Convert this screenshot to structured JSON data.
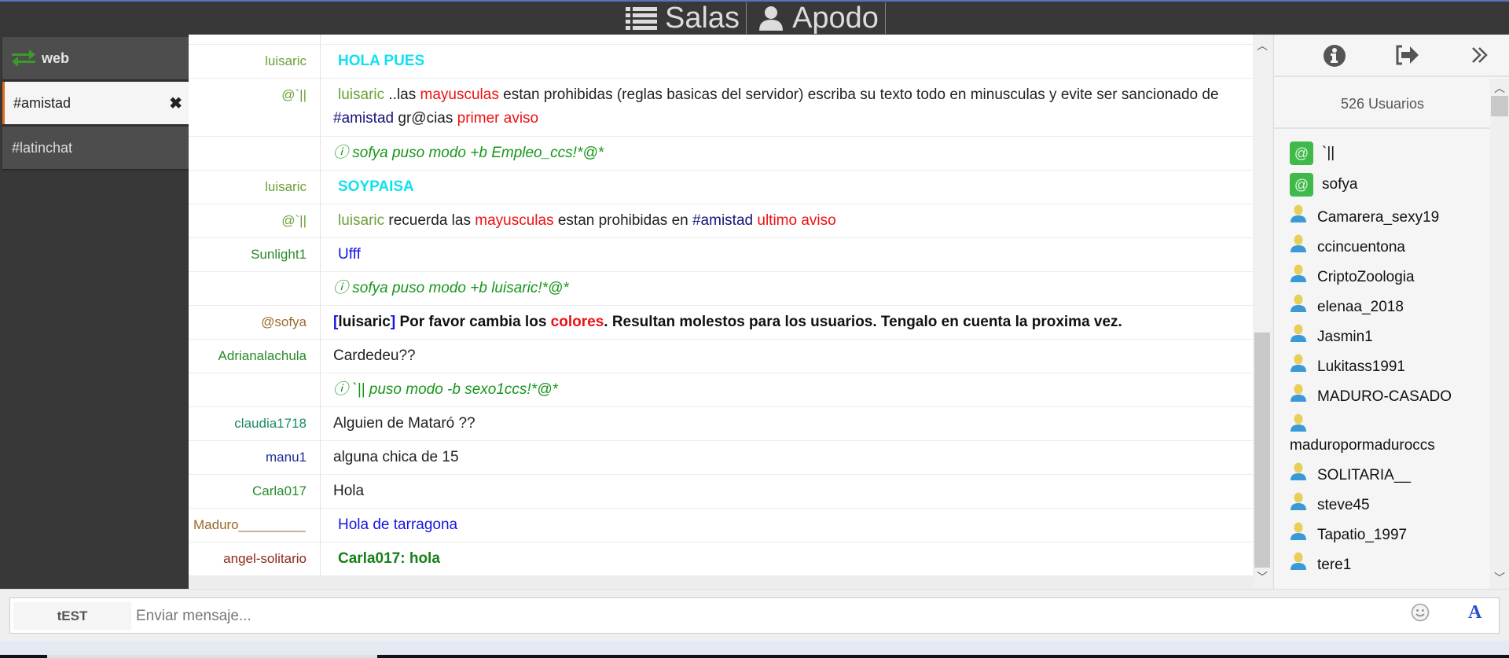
{
  "topbar": {
    "rooms_label": "Salas",
    "nick_label": "Apodo",
    "rooms_icon": "list-icon",
    "nick_icon": "user-icon"
  },
  "sidebar": {
    "server": {
      "label": "web",
      "icon": "exchange-arrows-icon",
      "icon_color": "#3a9a2a"
    },
    "channels": [
      {
        "label": "#amistad",
        "active": true,
        "close_label": "✖"
      },
      {
        "label": "#latinchat",
        "active": false
      }
    ],
    "active_accent": "#e36d1f"
  },
  "messages": [
    {
      "nick": "luisaric",
      "parts": [
        {
          "text": "HOLA PUES",
          "style": "cyan"
        }
      ]
    },
    {
      "nick": "@`||",
      "parts": [
        {
          "text": "luisaric",
          "style": "green"
        },
        {
          "text": " ..las  ",
          "style": "plain"
        },
        {
          "text": "mayusculas",
          "style": "red"
        },
        {
          "text": "  estan prohibidas (reglas basicas del servidor) escriba su texto todo en minusculas y evite ser sancionado de  ",
          "style": "plain"
        },
        {
          "text": "#amistad",
          "style": "navy"
        },
        {
          "text": "  gr@cias ",
          "style": "plain"
        },
        {
          "text": "primer aviso",
          "style": "red"
        }
      ]
    },
    {
      "nick": "",
      "notice": true,
      "parts": [
        {
          "text": "ⓘ sofya puso modo +b Empleo_ccs!*@*",
          "style": "notice"
        }
      ]
    },
    {
      "nick": "luisaric",
      "parts": [
        {
          "text": "SOYPAISA",
          "style": "cyan"
        }
      ]
    },
    {
      "nick": "@`||",
      "parts": [
        {
          "text": "luisaric",
          "style": "green"
        },
        {
          "text": " recuerda las  ",
          "style": "plain"
        },
        {
          "text": "mayusculas",
          "style": "red"
        },
        {
          "text": "  estan prohibidas en  ",
          "style": "plain"
        },
        {
          "text": "#amistad",
          "style": "navy"
        },
        {
          "text": "  ",
          "style": "plain"
        },
        {
          "text": "ultimo aviso",
          "style": "red"
        }
      ]
    },
    {
      "nick": "Sunlight1",
      "parts": [
        {
          "text": "Ufff",
          "style": "blue"
        }
      ]
    },
    {
      "nick": "",
      "notice": true,
      "parts": [
        {
          "text": "ⓘ sofya puso modo +b luisaric!*@*",
          "style": "notice"
        }
      ]
    },
    {
      "nick": "@sofya",
      "parts": [
        {
          "text": "[",
          "style": "boldblue"
        },
        {
          "text": "luisaric",
          "style": "bold"
        },
        {
          "text": "]",
          "style": "boldblue"
        },
        {
          "text": " Por favor cambia los ",
          "style": "bold"
        },
        {
          "text": "colores",
          "style": "boldred"
        },
        {
          "text": ". Resultan molestos para los usuarios. Tengalo en cuenta la proxima vez.",
          "style": "bold"
        }
      ]
    },
    {
      "nick": "Adrianalachula",
      "parts": [
        {
          "text": "Cardedeu??",
          "style": "plain"
        }
      ]
    },
    {
      "nick": "",
      "notice": true,
      "parts": [
        {
          "text": "ⓘ `|| puso modo -b sexo1ccs!*@*",
          "style": "notice"
        }
      ]
    },
    {
      "nick": "claudia1718",
      "parts": [
        {
          "text": "Alguien de Mataró ??",
          "style": "plain"
        }
      ]
    },
    {
      "nick": "manu1",
      "parts": [
        {
          "text": "alguna chica de 15",
          "style": "plain"
        }
      ]
    },
    {
      "nick": "Carla017",
      "parts": [
        {
          "text": "Hola",
          "style": "plain"
        }
      ]
    },
    {
      "nick": "Maduro_________",
      "parts": [
        {
          "text": "Hola de tarragona",
          "style": "blue"
        }
      ]
    },
    {
      "nick": "angel-solitario",
      "parts": [
        {
          "text": "Carla017:  hola",
          "style": "boldgreen"
        }
      ]
    }
  ],
  "right_panel": {
    "icons": [
      "info-icon",
      "logout-icon",
      "collapse-double-chevron-icon"
    ],
    "user_count_label": "526 Usuarios",
    "users": [
      {
        "name": "`||",
        "op": true
      },
      {
        "name": "sofya",
        "op": true
      },
      {
        "name": "Camarera_sexy19",
        "op": false
      },
      {
        "name": "ccincuentona",
        "op": false
      },
      {
        "name": "CriptoZoologia",
        "op": false
      },
      {
        "name": "elenaa_2018",
        "op": false
      },
      {
        "name": "Jasmin1",
        "op": false
      },
      {
        "name": "Lukitass1991",
        "op": false
      },
      {
        "name": "MADURO-CASADO",
        "op": false
      },
      {
        "name": "maduropormaduroccs",
        "op": false
      },
      {
        "name": "SOLITARIA__",
        "op": false
      },
      {
        "name": "steve45",
        "op": false
      },
      {
        "name": "Tapatio_1997",
        "op": false
      },
      {
        "name": "tere1",
        "op": false
      }
    ],
    "op_badge": "@",
    "op_color": "#3fb94a"
  },
  "inputbar": {
    "nick_button": "tEST",
    "placeholder": "Enviar mensaje...",
    "value": "",
    "emoji_icon": "smiley-icon",
    "font_button": "A"
  }
}
